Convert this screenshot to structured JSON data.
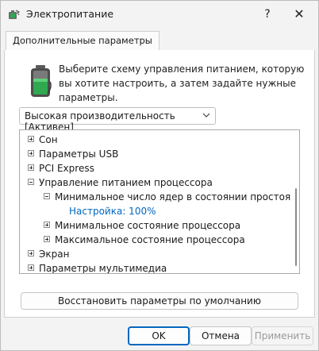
{
  "window": {
    "title": "Электропитание",
    "help_label": "?",
    "close_label": "✕"
  },
  "tabs": [
    {
      "label": "Дополнительные параметры",
      "active": true
    }
  ],
  "description": "Выберите схему управления питанием, которую вы хотите настроить, а затем задайте нужные параметры.",
  "scheme_select": {
    "value": "Высокая производительность [Активен]"
  },
  "tree": {
    "items": [
      {
        "label": "Сон",
        "expander": "plus",
        "level": 0
      },
      {
        "label": "Параметры USB",
        "expander": "plus",
        "level": 0
      },
      {
        "label": "PCI Express",
        "expander": "plus",
        "level": 0
      },
      {
        "label": "Управление питанием процессора",
        "expander": "minus",
        "level": 0
      },
      {
        "label": "Минимальное число ядер в состоянии простоя",
        "expander": "minus",
        "level": 1
      },
      {
        "label": "Настройка: 100%",
        "expander": "none",
        "level": 2
      },
      {
        "label": "Минимальное состояние процессора",
        "expander": "plus",
        "level": 1
      },
      {
        "label": "Максимальное состояние процессора",
        "expander": "plus",
        "level": 1
      },
      {
        "label": "Экран",
        "expander": "plus",
        "level": 0
      },
      {
        "label": "Параметры мультимедиа",
        "expander": "plus",
        "level": 0
      }
    ]
  },
  "buttons": {
    "restore": "Восстановить параметры по умолчанию",
    "ok": "OK",
    "cancel": "Отмена",
    "apply": "Применить"
  },
  "colors": {
    "accent": "#0067c0",
    "battery_green": "#2fa84f"
  }
}
